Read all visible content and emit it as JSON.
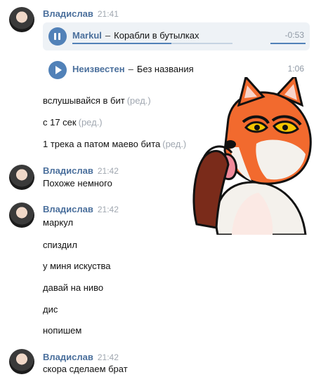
{
  "messages": [
    {
      "author": "Владислав",
      "time": "21:41",
      "audio": [
        {
          "artist": "Markul",
          "dash": "–",
          "title": "Корабли в бутылках",
          "duration": "-0:53",
          "state": "playing",
          "progress": 0.62
        },
        {
          "artist": "Неизвестен",
          "dash": "–",
          "title": "Без названия",
          "duration": "1:06",
          "state": "paused"
        }
      ],
      "lines": [
        {
          "text": "вслушывайся в бит",
          "edited": "(ред.)"
        },
        {
          "text": "с 17 сек",
          "edited": "(ред.)"
        },
        {
          "text": "1 трека а патом маево бита",
          "edited": "(ред.)"
        }
      ]
    },
    {
      "author": "Владислав",
      "time": "21:42",
      "lines": [
        {
          "text": "Похоже немного"
        }
      ]
    },
    {
      "author": "Владислав",
      "time": "21:42",
      "lines": [
        {
          "text": "маркул"
        },
        {
          "text": "спиздил"
        },
        {
          "text": "у миня искуства"
        },
        {
          "text": "давай на ниво"
        },
        {
          "text": "дис"
        },
        {
          "text": "нопишем"
        }
      ]
    },
    {
      "author": "Владислав",
      "time": "21:42",
      "lines": [
        {
          "text": "скора сделаем брат"
        }
      ]
    }
  ],
  "sticker": {
    "description": "fox-sticker"
  },
  "colors": {
    "accent": "#5181b8",
    "author": "#4a6f9c",
    "meta": "#a0a7b0"
  }
}
